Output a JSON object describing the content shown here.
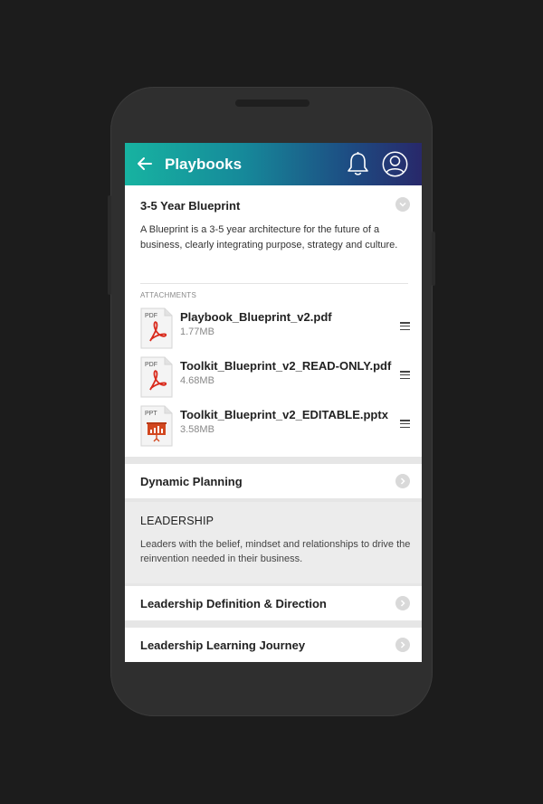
{
  "appbar": {
    "title": "Playbooks"
  },
  "blueprint": {
    "title": "3-5 Year Blueprint",
    "description": "A Blueprint is a 3-5 year architecture for the future of a business, clearly integrating purpose, strategy and culture.",
    "attachments_label": "ATTACHMENTS",
    "files": [
      {
        "type": "PDF",
        "name": "Playbook_Blueprint_v2.pdf",
        "size": "1.77MB"
      },
      {
        "type": "PDF",
        "name": "Toolkit_Blueprint_v2_READ-ONLY.pdf",
        "size": "4.68MB"
      },
      {
        "type": "PPT",
        "name": "Toolkit_Blueprint_v2_EDITABLE.pptx",
        "size": "3.58MB"
      }
    ]
  },
  "dynamic_planning": {
    "title": "Dynamic Planning"
  },
  "leadership": {
    "heading": "LEADERSHIP",
    "description": "Leaders with the belief, mindset and relationships to drive the reinvention needed in their business."
  },
  "leadership_items": [
    {
      "title": "Leadership Definition & Direction"
    },
    {
      "title": "Leadership Learning Journey"
    }
  ],
  "colors": {
    "pdf_red": "#d92a1c",
    "ppt_orange": "#d2471f",
    "gradient_start": "#17b3a1",
    "gradient_end": "#28286a"
  }
}
